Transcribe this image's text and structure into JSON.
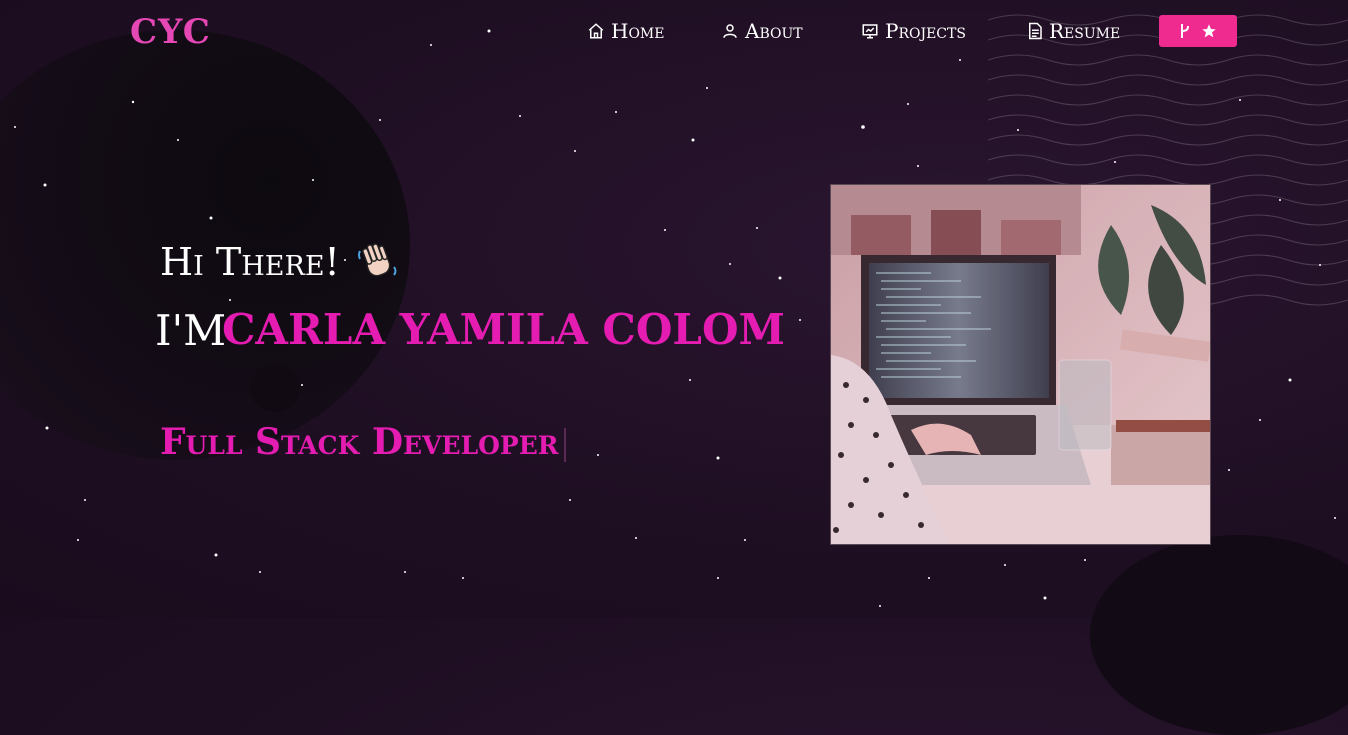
{
  "nav": {
    "logo": "CYC",
    "items": [
      {
        "label": "Home",
        "icon": "home-icon"
      },
      {
        "label": "About",
        "icon": "user-icon"
      },
      {
        "label": "Projects",
        "icon": "projects-icon"
      },
      {
        "label": "Resume",
        "icon": "document-icon"
      }
    ],
    "star_button": {
      "icons": [
        "fork-icon",
        "star-icon"
      ]
    }
  },
  "hero": {
    "greeting": "Hi There!",
    "greeting_emoji": "waving-hand",
    "im_prefix": "I'M",
    "name": "CARLA YAMILA COLOM",
    "role": "Full Stack Developer",
    "image": "woman-typing-on-laptop-photo"
  },
  "colors": {
    "accent": "#e51cb1",
    "button": "#f02b8f",
    "background": "#1f0f23"
  }
}
